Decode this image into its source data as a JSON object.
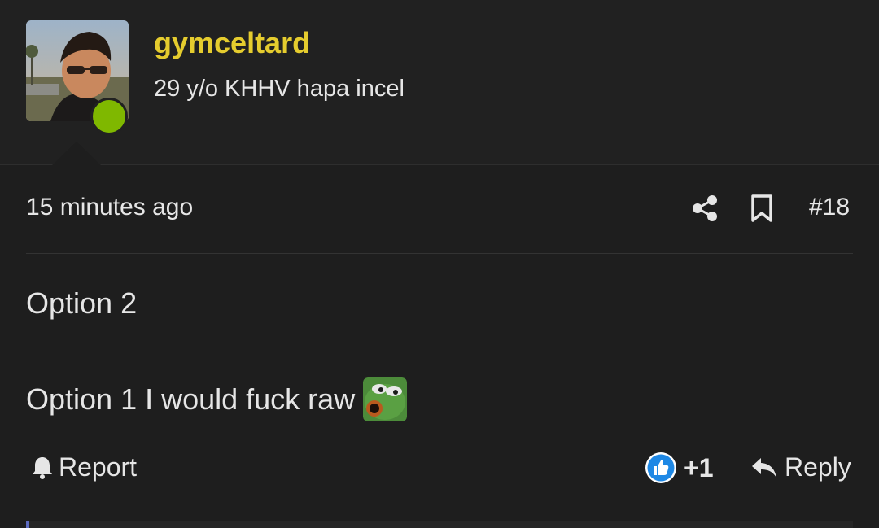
{
  "user": {
    "username": "gymceltard",
    "title": "29 y/o KHHV hapa incel",
    "online": true
  },
  "post": {
    "time": "15 minutes ago",
    "number": "#18",
    "lines": [
      "Option 2",
      "Option 1 I would fuck raw"
    ],
    "emoji": "pepe-frog-emoji"
  },
  "actions": {
    "share_icon": "share-icon",
    "bookmark_icon": "bookmark-icon",
    "report_label": "Report",
    "report_icon": "bell-icon",
    "like_icon": "thumbs-up-icon",
    "like_count": "+1",
    "reply_label": "Reply",
    "reply_icon": "reply-arrow-icon"
  },
  "colors": {
    "background": "#1e1e1e",
    "username": "#e5cc2e",
    "online": "#7fb800",
    "like": "#1e88e5"
  }
}
